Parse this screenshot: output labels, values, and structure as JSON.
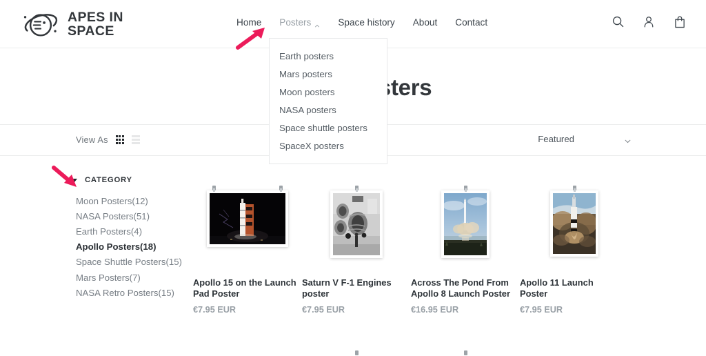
{
  "brand": {
    "name_line1": "APES IN",
    "name_line2": "SPACE",
    "logo_icon": "saturn-ape-logo"
  },
  "header": {
    "nav": [
      {
        "label": "Home",
        "active": false,
        "has_caret": false
      },
      {
        "label": "Posters",
        "active": true,
        "has_caret": true
      },
      {
        "label": "Space history",
        "active": false,
        "has_caret": false
      },
      {
        "label": "About",
        "active": false,
        "has_caret": false
      },
      {
        "label": "Contact",
        "active": false,
        "has_caret": false
      }
    ],
    "icons": [
      {
        "name": "search-icon",
        "label": "Search"
      },
      {
        "name": "account-icon",
        "label": "Account"
      },
      {
        "name": "cart-icon",
        "label": "Cart"
      }
    ]
  },
  "dropdown": {
    "open": true,
    "parent": "Posters",
    "items": [
      "Earth posters",
      "Mars posters",
      "Moon posters",
      "NASA posters",
      "Space shuttle posters",
      "SpaceX posters"
    ]
  },
  "page": {
    "title": "Apollo Posters"
  },
  "toolbar": {
    "view_as_label": "View As",
    "view_grid_icon": "grid-view-icon",
    "view_list_icon": "list-view-icon",
    "active_view": "grid",
    "sort_value": "Featured",
    "sort_caret_icon": "chevron-down-icon"
  },
  "sidebar": {
    "section_title": "CATEGORY",
    "collapse_icon": "triangle-down-icon",
    "expanded": true,
    "items": [
      {
        "label": "Moon Posters(12)",
        "active": false
      },
      {
        "label": "NASA Posters(51)",
        "active": false
      },
      {
        "label": "Earth Posters(4)",
        "active": false
      },
      {
        "label": "Apollo Posters(18)",
        "active": true
      },
      {
        "label": "Space Shuttle Posters(15)",
        "active": false
      },
      {
        "label": "Mars Posters(7)",
        "active": false
      },
      {
        "label": "NASA Retro Posters(15)",
        "active": false
      }
    ]
  },
  "products": [
    {
      "title": "Apollo 15 on the Launch Pad Poster",
      "price": "€7.95 EUR",
      "orientation": "landscape",
      "image_alt": "rocket-on-launch-pad-night"
    },
    {
      "title": "Saturn V F-1 Engines poster",
      "price": "€7.95 EUR",
      "orientation": "portrait",
      "image_alt": "saturn-v-f1-engines-bw"
    },
    {
      "title": "Across The Pond From Apollo 8 Launch Poster",
      "price": "€16.95 EUR",
      "orientation": "portrait",
      "image_alt": "rocket-launch-over-water"
    },
    {
      "title": "Apollo 11 Launch Poster",
      "price": "€7.95 EUR",
      "orientation": "portrait",
      "image_alt": "apollo-11-liftoff"
    }
  ],
  "annotations": [
    {
      "name": "arrow-pointing-to-posters-nav",
      "color": "#ec1b5a",
      "direction": "up-right"
    },
    {
      "name": "arrow-pointing-to-category-filter",
      "color": "#ec1b5a",
      "direction": "down-right"
    }
  ],
  "colors": {
    "accent_pink": "#ec1b5a",
    "text_dark": "#2e3439",
    "text_muted": "#9aa1a7",
    "border": "#eceded"
  }
}
